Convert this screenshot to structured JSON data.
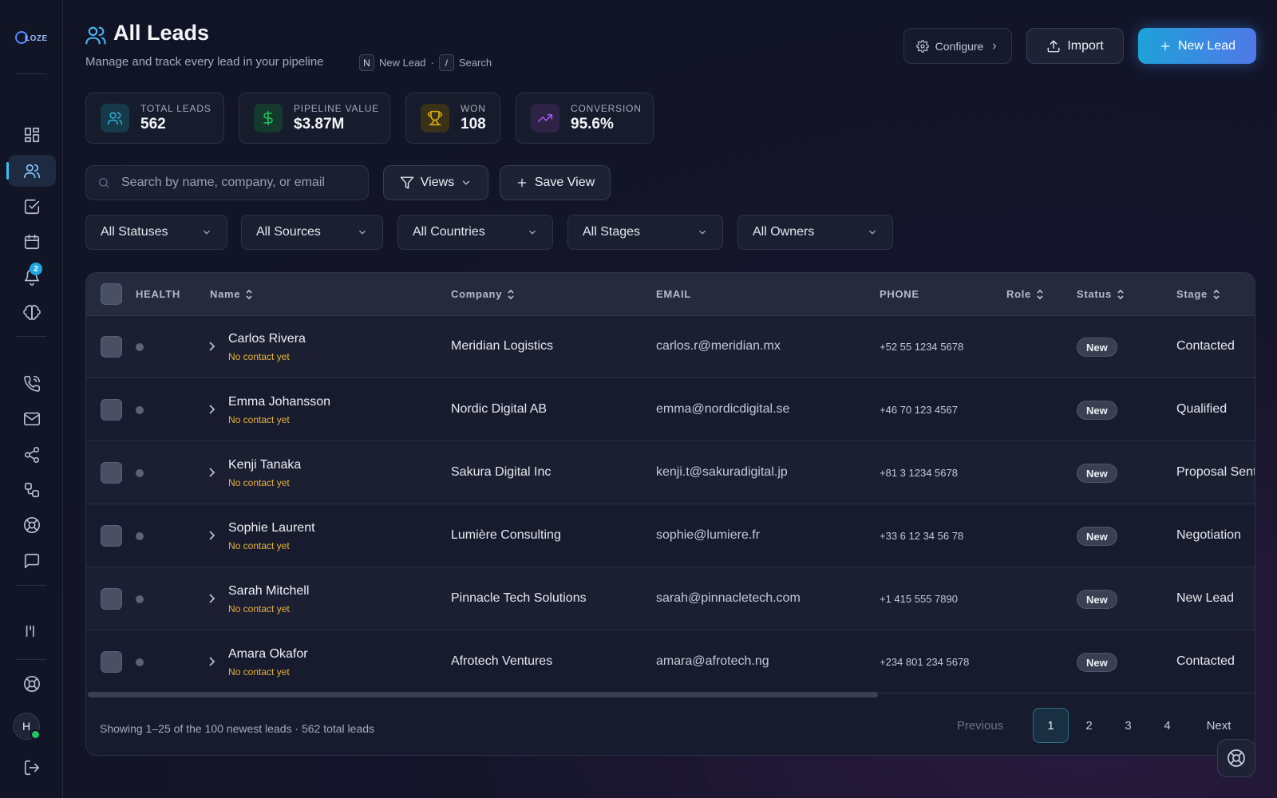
{
  "app": {
    "logo_text": "CLOZE"
  },
  "sidebar": {
    "notifications_count": "2",
    "avatar_initial": "H"
  },
  "header": {
    "title": "All Leads",
    "subtitle": "Manage and track every lead in your pipeline",
    "shortcuts": [
      {
        "key": "N",
        "label": "New Lead"
      },
      {
        "key": "/",
        "label": "Search"
      }
    ],
    "separator": "·",
    "configure_label": "Configure",
    "import_label": "Import",
    "new_lead_label": "New Lead"
  },
  "stats": [
    {
      "label": "TOTAL LEADS",
      "value": "562",
      "icon": "users-icon",
      "color": "#2ab3d8"
    },
    {
      "label": "PIPELINE VALUE",
      "value": "$3.87M",
      "icon": "dollar-icon",
      "color": "#22c55e"
    },
    {
      "label": "WON",
      "value": "108",
      "icon": "trophy-icon",
      "color": "#eab308"
    },
    {
      "label": "CONVERSION",
      "value": "95.6%",
      "icon": "trending-up-icon",
      "color": "#a855f7"
    }
  ],
  "toolbar": {
    "search_placeholder": "Search by name, company, or email",
    "views_label": "Views",
    "save_view_label": "Save View"
  },
  "filters": [
    "All Statuses",
    "All Sources",
    "All Countries",
    "All Stages",
    "All Owners"
  ],
  "table": {
    "columns": {
      "health": "HEALTH",
      "name": "Name",
      "company": "Company",
      "email": "EMAIL",
      "phone": "PHONE",
      "role": "Role",
      "status": "Status",
      "stage": "Stage"
    },
    "rows": [
      {
        "name": "Carlos Rivera",
        "note": "No contact yet",
        "company": "Meridian Logistics",
        "email": "carlos.r@meridian.mx",
        "phone": "+52 55 1234 5678",
        "status": "New",
        "stage": "Contacted"
      },
      {
        "name": "Emma Johansson",
        "note": "No contact yet",
        "company": "Nordic Digital AB",
        "email": "emma@nordicdigital.se",
        "phone": "+46 70 123 4567",
        "status": "New",
        "stage": "Qualified"
      },
      {
        "name": "Kenji Tanaka",
        "note": "No contact yet",
        "company": "Sakura Digital Inc",
        "email": "kenji.t@sakuradigital.jp",
        "phone": "+81 3 1234 5678",
        "status": "New",
        "stage": "Proposal Sent"
      },
      {
        "name": "Sophie Laurent",
        "note": "No contact yet",
        "company": "Lumière Consulting",
        "email": "sophie@lumiere.fr",
        "phone": "+33 6 12 34 56 78",
        "status": "New",
        "stage": "Negotiation"
      },
      {
        "name": "Sarah Mitchell",
        "note": "No contact yet",
        "company": "Pinnacle Tech Solutions",
        "email": "sarah@pinnacletech.com",
        "phone": "+1 415 555 7890",
        "status": "New",
        "stage": "New Lead"
      },
      {
        "name": "Amara Okafor",
        "note": "No contact yet",
        "company": "Afrotech Ventures",
        "email": "amara@afrotech.ng",
        "phone": "+234 801 234 5678",
        "status": "New",
        "stage": "Contacted"
      }
    ]
  },
  "footer": {
    "summary": "Showing 1–25 of the 100 newest leads · 562 total leads",
    "previous_label": "Previous",
    "pages": [
      "1",
      "2",
      "3",
      "4"
    ],
    "next_label": "Next"
  },
  "colors": {
    "accent": "#39c1f0",
    "warning": "#e8b23a",
    "online": "#22c55e"
  }
}
